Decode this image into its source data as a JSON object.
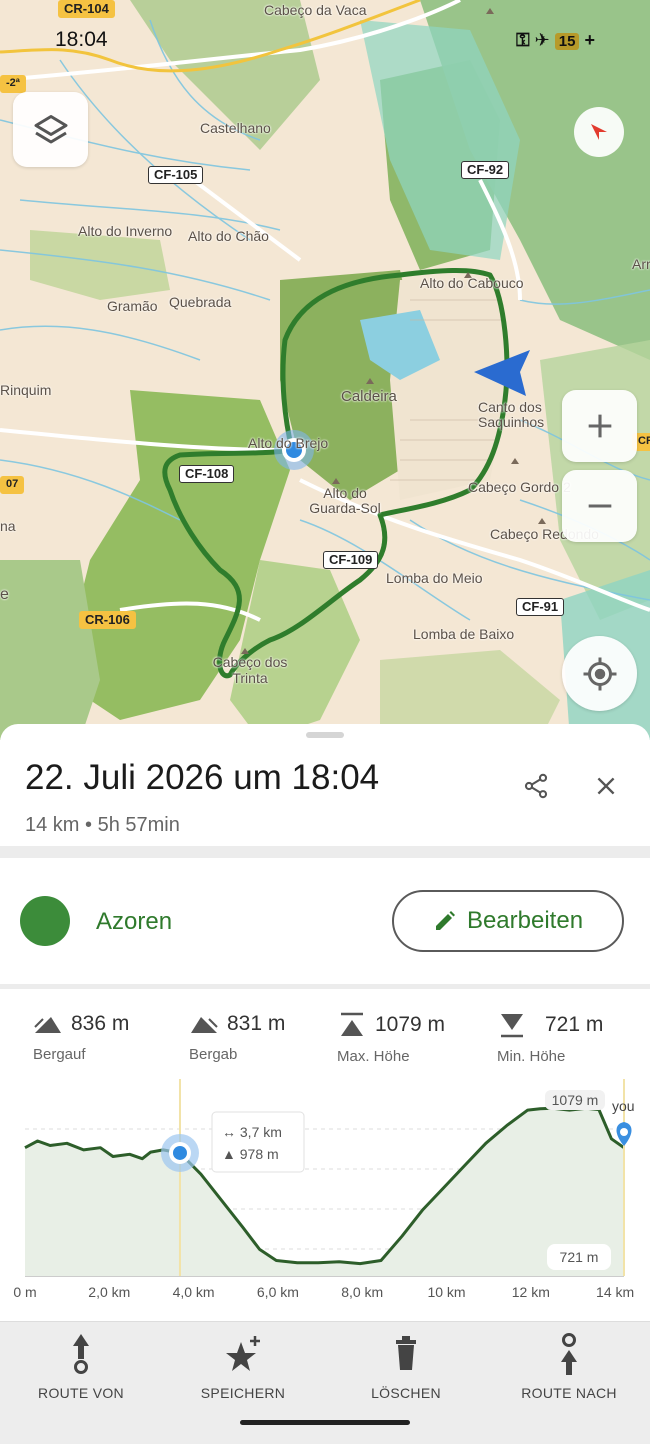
{
  "status_bar": {
    "time": "18:04",
    "battery": "15"
  },
  "map": {
    "places": {
      "cabeco_da_vaca": "Cabeço da Vaca",
      "castelhano": "Castelhano",
      "alto_do_inverno": "Alto do Inverno",
      "alto_do_chao": "Alto do Chão",
      "gramao": "Gramão",
      "quebrada": "Quebrada",
      "rinquim": "Rinquim",
      "alto_do_cabouco": "Alto do Cabouco",
      "caldeira": "Caldeira",
      "canto_dos_saquinhos": "Canto dos Saquinhos",
      "alto_do_brejo": "Alto do Brejo",
      "alto_do_guarda_sol": "Alto do Guarda-Sol",
      "cabeco_gordo": "Cabeço Gordo 2",
      "cabeco_redondo": "Cabeço Redondo",
      "lomba_do_meio": "Lomba do Meio",
      "lomba_de_baixo": "Lomba de Baixo",
      "cabeco_dos_trinta": "Cabeço dos Trinta",
      "arr": "Arr",
      "edge_2a": "-2ª",
      "edge_07": "07",
      "edge_na": "na",
      "edge_e": "e"
    },
    "roads": {
      "cr104": "CR-104",
      "cf105": "CF-105",
      "cf92": "CF-92",
      "cf108": "CF-108",
      "cf109": "CF-109",
      "cf91": "CF-91",
      "cr106": "CR-106",
      "cr_edge": "CR"
    }
  },
  "track": {
    "title": "22. Juli 2026 um 18:04",
    "summary": "14 km • 5h 57min",
    "group_name": "Azoren",
    "group_color": "#3c8c3a",
    "edit_label": "Bearbeiten"
  },
  "stats": [
    {
      "icon": "uphill-icon",
      "value": "836 m",
      "label": "Bergauf"
    },
    {
      "icon": "downhill-icon",
      "value": "831 m",
      "label": "Bergab"
    },
    {
      "icon": "max-altitude-icon",
      "value": "1079 m",
      "label": "Max. Höhe"
    },
    {
      "icon": "min-altitude-icon",
      "value": "721 m",
      "label": "Min. Höhe"
    }
  ],
  "chart_data": {
    "type": "area",
    "xlabel": "",
    "ylabel": "",
    "x_ticks": [
      "0 m",
      "2,0 km",
      "4,0 km",
      "6,0 km",
      "8,0 km",
      "10 km",
      "12 km",
      "14 km"
    ],
    "xlim": [
      0,
      14.3
    ],
    "ylim": [
      700,
      1100
    ],
    "max_label": "1079 m",
    "min_label": "721 m",
    "marker_label": "you",
    "tooltip": {
      "distance": "3,7 km",
      "elevation": "978 m"
    },
    "cursor_x": 3.7,
    "series": [
      {
        "x": [
          0,
          0.3,
          0.6,
          1.0,
          1.4,
          1.8,
          2.1,
          2.5,
          2.8,
          3.0,
          3.3,
          3.7,
          4.2,
          4.7,
          5.2,
          5.6,
          6.0,
          6.5,
          7.0,
          7.5,
          8.0,
          8.5,
          9.0,
          9.5,
          10.0,
          10.5,
          11.0,
          11.5,
          12.0,
          12.3,
          12.6,
          13.0,
          13.4,
          13.7,
          14.0,
          14.3
        ],
        "y": [
          990,
          1005,
          995,
          1000,
          985,
          990,
          970,
          975,
          965,
          980,
          985,
          978,
          930,
          870,
          810,
          760,
          735,
          730,
          730,
          732,
          728,
          735,
          790,
          850,
          900,
          950,
          1000,
          1040,
          1075,
          1078,
          1079,
          1075,
          1079,
          1076,
          1010,
          990
        ]
      }
    ]
  },
  "toolbar": [
    {
      "icon": "route-from-icon",
      "label": "ROUTE VON"
    },
    {
      "icon": "star-add-icon",
      "label": "SPEICHERN"
    },
    {
      "icon": "trash-icon",
      "label": "LÖSCHEN"
    },
    {
      "icon": "route-to-icon",
      "label": "ROUTE NACH"
    }
  ]
}
